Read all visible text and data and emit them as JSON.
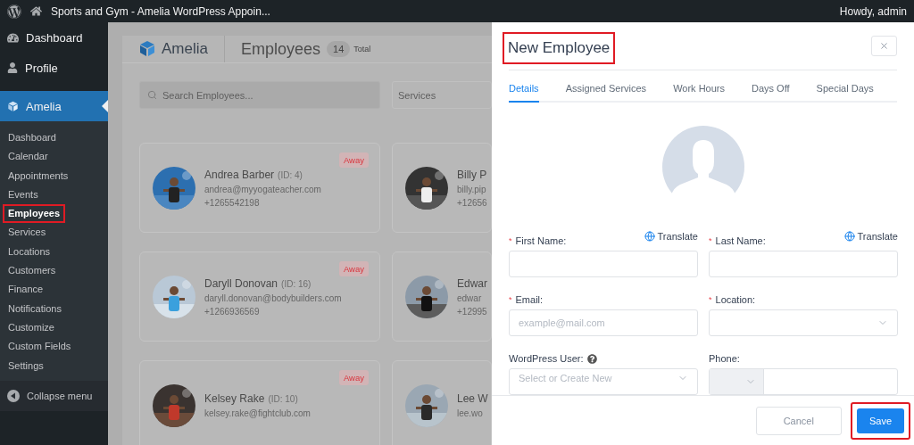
{
  "admin_bar": {
    "site_title": "Sports and Gym - Amelia WordPress Appoin...",
    "greeting": "Howdy, admin"
  },
  "sidebar": {
    "items": [
      {
        "label": "Dashboard",
        "kind": "dashboard",
        "selected": false
      },
      {
        "label": "Profile",
        "kind": "profile",
        "selected": false
      },
      {
        "label": "Amelia",
        "kind": "amelia",
        "selected": true
      }
    ],
    "submenu": [
      {
        "label": "Dashboard",
        "selected": false,
        "highlighted": false
      },
      {
        "label": "Calendar",
        "selected": false,
        "highlighted": false
      },
      {
        "label": "Appointments",
        "selected": false,
        "highlighted": false
      },
      {
        "label": "Events",
        "selected": false,
        "highlighted": false
      },
      {
        "label": "Employees",
        "selected": true,
        "highlighted": true
      },
      {
        "label": "Services",
        "selected": false,
        "highlighted": false
      },
      {
        "label": "Locations",
        "selected": false,
        "highlighted": false
      },
      {
        "label": "Customers",
        "selected": false,
        "highlighted": false
      },
      {
        "label": "Finance",
        "selected": false,
        "highlighted": false
      },
      {
        "label": "Notifications",
        "selected": false,
        "highlighted": false
      },
      {
        "label": "Customize",
        "selected": false,
        "highlighted": false
      },
      {
        "label": "Custom Fields",
        "selected": false,
        "highlighted": false
      },
      {
        "label": "Settings",
        "selected": false,
        "highlighted": false
      }
    ],
    "collapse": "Collapse menu"
  },
  "header": {
    "brand": "Amelia",
    "title": "Employees",
    "count": "14",
    "count_label": "Total"
  },
  "search": {
    "placeholder": "Search Employees..."
  },
  "services_filter": {
    "placeholder": "Services"
  },
  "employees": [
    {
      "name": "Andrea Barber",
      "id": "(ID: 4)",
      "email": "andrea@myyogateacher.com",
      "phone": "+1265542198",
      "status": "Away"
    },
    {
      "name": "Billy P",
      "email": "billy.pip",
      "phone": "+12656"
    },
    {
      "name": "Daryll Donovan",
      "id": "(ID: 16)",
      "email": "daryll.donovan@bodybuilders.com",
      "phone": "+1266936569",
      "status": "Away"
    },
    {
      "name": "Edwar",
      "email": "edwar",
      "phone": "+12995"
    },
    {
      "name": "Kelsey Rake",
      "id": "(ID: 10)",
      "email": "kelsey.rake@fightclub.com",
      "status": "Away"
    },
    {
      "name": "Lee W",
      "email": "lee.wo"
    }
  ],
  "modal": {
    "title": "New Employee",
    "title_highlighted": true,
    "tabs": [
      {
        "label": "Details",
        "selected": true
      },
      {
        "label": "Assigned Services",
        "selected": false
      },
      {
        "label": "Work Hours",
        "selected": false
      },
      {
        "label": "Days Off",
        "selected": false
      },
      {
        "label": "Special Days",
        "selected": false
      }
    ],
    "fields": [
      {
        "label": "First Name:",
        "marker": "*",
        "translate": "Translate",
        "kind": "text"
      },
      {
        "label": "Last Name:",
        "marker": "*",
        "translate": "Translate",
        "kind": "text"
      },
      {
        "label": "Email:",
        "marker": "*",
        "placeholder": "example@mail.com",
        "kind": "text"
      },
      {
        "label": "Location:",
        "marker": "*",
        "kind": "select"
      },
      {
        "label": "WordPress User:",
        "help": true,
        "placeholder": "Select or Create New",
        "kind": "select"
      },
      {
        "label": "Phone:",
        "kind": "phone"
      }
    ],
    "buttons": [
      {
        "label": "Cancel",
        "kind": "secondary",
        "highlighted": false
      },
      {
        "label": "Save",
        "kind": "primary",
        "highlighted": true
      }
    ]
  }
}
